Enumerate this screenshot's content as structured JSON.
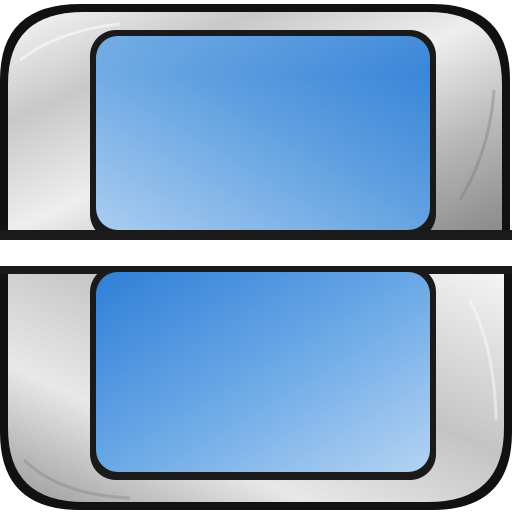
{
  "icon": {
    "name": "dual-screen-handheld-icon",
    "colors": {
      "background": "#ffffff",
      "shell_edge_dark": "#101010",
      "metal_highlight": "#f7f7f7",
      "metal_mid": "#c8c8c8",
      "metal_shadow": "#8a8a8a",
      "screen_bezel": "#1a1a1a",
      "screen_blue_dark": "#2f7fd6",
      "screen_blue_light": "#a9cdf0"
    },
    "parts": [
      "top-shell",
      "top-screen",
      "bottom-shell",
      "bottom-screen"
    ]
  }
}
